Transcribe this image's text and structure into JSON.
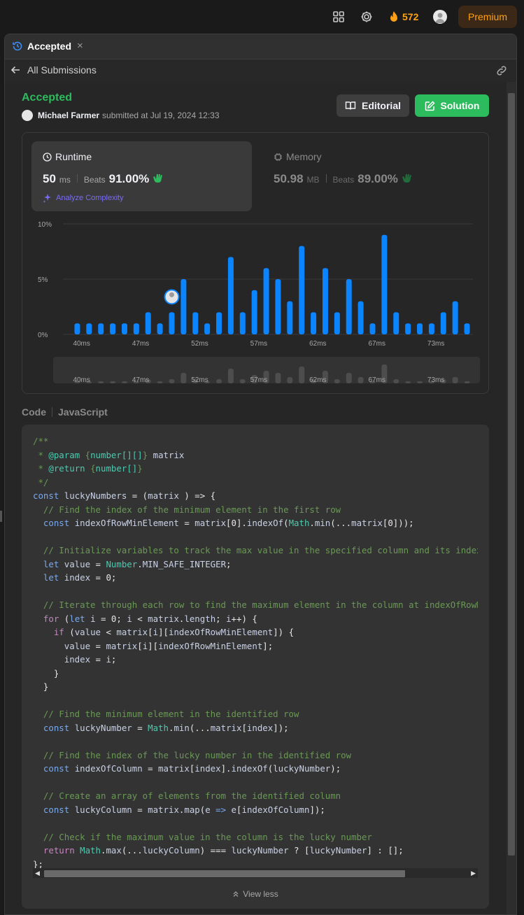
{
  "topbar": {
    "streak_count": "572",
    "premium_label": "Premium",
    "icons": [
      "layout-icon",
      "gear-icon",
      "fire-icon",
      "avatar"
    ],
    "accent": "#ffa116"
  },
  "tab": {
    "label": "Accepted",
    "close": "×"
  },
  "subbar": {
    "back_label": "All Submissions"
  },
  "submission": {
    "status": "Accepted",
    "status_color": "#2cbb5d",
    "user": "Michael Farmer",
    "submitted_text": "submitted at Jul 19, 2024 12:33"
  },
  "buttons": {
    "editorial": "Editorial",
    "solution": "Solution"
  },
  "runtime": {
    "label": "Runtime",
    "value": "50",
    "unit": "ms",
    "beats_label": "Beats",
    "beats_pct": "91.00%",
    "analyze_label": "Analyze Complexity"
  },
  "memory": {
    "label": "Memory",
    "value": "50.98",
    "unit": "MB",
    "beats_label": "Beats",
    "beats_pct": "89.00%"
  },
  "chart_data": {
    "type": "bar",
    "y_ticks": [
      "10%",
      "5%",
      "0%"
    ],
    "ylim": [
      0,
      10
    ],
    "x_tick_labels": [
      "40ms",
      "47ms",
      "52ms",
      "57ms",
      "62ms",
      "67ms",
      "73ms"
    ],
    "values": [
      1,
      1,
      1,
      1,
      1,
      1,
      2,
      1,
      2,
      5,
      2,
      1,
      2,
      7,
      2,
      4,
      6,
      5,
      3,
      8,
      2,
      6,
      2,
      5,
      3,
      1,
      9,
      2,
      1,
      1,
      1,
      2,
      3,
      1
    ],
    "highlight_index": 8,
    "bar_color": "#0a84ff"
  },
  "code_section": {
    "label": "Code",
    "language": "JavaScript",
    "view_less": "View less"
  },
  "code_lines": [
    [
      [
        "c",
        "/**"
      ]
    ],
    [
      [
        "c",
        " * "
      ],
      [
        "t",
        "@param"
      ],
      [
        "c",
        " {"
      ],
      [
        "t",
        "number[][]"
      ],
      [
        "c",
        "} "
      ],
      [
        "v",
        "matrix"
      ]
    ],
    [
      [
        "c",
        " * "
      ],
      [
        "t",
        "@return"
      ],
      [
        "c",
        " {"
      ],
      [
        "t",
        "number[]"
      ],
      [
        "c",
        "}"
      ]
    ],
    [
      [
        "c",
        " */"
      ]
    ],
    [
      [
        "k",
        "const "
      ],
      [
        "v",
        "luckyNumbers "
      ],
      [
        "",
        "= ("
      ],
      [
        "v",
        "matrix"
      ],
      [
        "",
        " ) => {"
      ]
    ],
    [
      [
        "c",
        "  // Find the index of the minimum element in the first row"
      ]
    ],
    [
      [
        "k",
        "  const "
      ],
      [
        "v",
        "indexOfRowMinElement "
      ],
      [
        "",
        "= "
      ],
      [
        "v",
        "matrix"
      ],
      [
        "",
        "[0]."
      ],
      [
        "v",
        "indexOf"
      ],
      [
        "",
        "("
      ],
      [
        "t",
        "Math"
      ],
      [
        "",
        "."
      ],
      [
        "v",
        "min"
      ],
      [
        "",
        "(..."
      ],
      [
        "v",
        "matrix"
      ],
      [
        "",
        "[0]));"
      ]
    ],
    [
      [
        "",
        ""
      ]
    ],
    [
      [
        "c",
        "  // Initialize variables to track the max value in the specified column and its index"
      ]
    ],
    [
      [
        "k",
        "  let "
      ],
      [
        "v",
        "value "
      ],
      [
        "",
        "= "
      ],
      [
        "t",
        "Number"
      ],
      [
        "",
        "."
      ],
      [
        "v",
        "MIN_SAFE_INTEGER"
      ],
      [
        "",
        ";"
      ]
    ],
    [
      [
        "k",
        "  let "
      ],
      [
        "v",
        "index "
      ],
      [
        "",
        "= 0;"
      ]
    ],
    [
      [
        "",
        ""
      ]
    ],
    [
      [
        "c",
        "  // Iterate through each row to find the maximum element in the column at indexOfRowMinElement"
      ]
    ],
    [
      [
        "kw",
        "  for "
      ],
      [
        "",
        "("
      ],
      [
        "k",
        "let "
      ],
      [
        "v",
        "i "
      ],
      [
        "",
        "= 0; "
      ],
      [
        "v",
        "i "
      ],
      [
        "",
        "< "
      ],
      [
        "v",
        "matrix"
      ],
      [
        "",
        "."
      ],
      [
        "v",
        "length"
      ],
      [
        "",
        "; "
      ],
      [
        "v",
        "i"
      ],
      [
        "",
        "++) {"
      ]
    ],
    [
      [
        "kw",
        "    if "
      ],
      [
        "",
        "("
      ],
      [
        "v",
        "value "
      ],
      [
        "",
        "< "
      ],
      [
        "v",
        "matrix"
      ],
      [
        "",
        "["
      ],
      [
        "v",
        "i"
      ],
      [
        "",
        "]["
      ],
      [
        "v",
        "indexOfRowMinElement"
      ],
      [
        "",
        "]) {"
      ]
    ],
    [
      [
        "v",
        "      value "
      ],
      [
        "",
        "= "
      ],
      [
        "v",
        "matrix"
      ],
      [
        "",
        "["
      ],
      [
        "v",
        "i"
      ],
      [
        "",
        "]["
      ],
      [
        "v",
        "indexOfRowMinElement"
      ],
      [
        "",
        "];"
      ]
    ],
    [
      [
        "v",
        "      index "
      ],
      [
        "",
        "= "
      ],
      [
        "v",
        "i"
      ],
      [
        "",
        ";"
      ]
    ],
    [
      [
        "",
        "    }"
      ]
    ],
    [
      [
        "",
        "  }"
      ]
    ],
    [
      [
        "",
        ""
      ]
    ],
    [
      [
        "c",
        "  // Find the minimum element in the identified row"
      ]
    ],
    [
      [
        "k",
        "  const "
      ],
      [
        "v",
        "luckyNumber "
      ],
      [
        "",
        "= "
      ],
      [
        "t",
        "Math"
      ],
      [
        "",
        "."
      ],
      [
        "v",
        "min"
      ],
      [
        "",
        "(..."
      ],
      [
        "v",
        "matrix"
      ],
      [
        "",
        "["
      ],
      [
        "v",
        "index"
      ],
      [
        "",
        "]);"
      ]
    ],
    [
      [
        "",
        ""
      ]
    ],
    [
      [
        "c",
        "  // Find the index of the lucky number in the identified row"
      ]
    ],
    [
      [
        "k",
        "  const "
      ],
      [
        "v",
        "indexOfColumn "
      ],
      [
        "",
        "= "
      ],
      [
        "v",
        "matrix"
      ],
      [
        "",
        "["
      ],
      [
        "v",
        "index"
      ],
      [
        "",
        "]."
      ],
      [
        "v",
        "indexOf"
      ],
      [
        "",
        "("
      ],
      [
        "v",
        "luckyNumber"
      ],
      [
        "",
        ");"
      ]
    ],
    [
      [
        "",
        ""
      ]
    ],
    [
      [
        "c",
        "  // Create an array of elements from the identified column"
      ]
    ],
    [
      [
        "k",
        "  const "
      ],
      [
        "v",
        "luckyColumn "
      ],
      [
        "",
        "= "
      ],
      [
        "v",
        "matrix"
      ],
      [
        "",
        "."
      ],
      [
        "v",
        "map"
      ],
      [
        "",
        "("
      ],
      [
        "v",
        "e "
      ],
      [
        "k",
        "=> "
      ],
      [
        "v",
        "e"
      ],
      [
        "",
        "["
      ],
      [
        "v",
        "indexOfColumn"
      ],
      [
        "",
        "]);"
      ]
    ],
    [
      [
        "",
        ""
      ]
    ],
    [
      [
        "c",
        "  // Check if the maximum value in the column is the lucky number"
      ]
    ],
    [
      [
        "kw",
        "  return "
      ],
      [
        "t",
        "Math"
      ],
      [
        "",
        "."
      ],
      [
        "v",
        "max"
      ],
      [
        "",
        "(..."
      ],
      [
        "v",
        "luckyColumn"
      ],
      [
        "",
        ") === "
      ],
      [
        "v",
        "luckyNumber "
      ],
      [
        "",
        "? ["
      ],
      [
        "v",
        "luckyNumber"
      ],
      [
        "",
        "] : [];"
      ]
    ],
    [
      [
        "",
        "};"
      ]
    ]
  ]
}
